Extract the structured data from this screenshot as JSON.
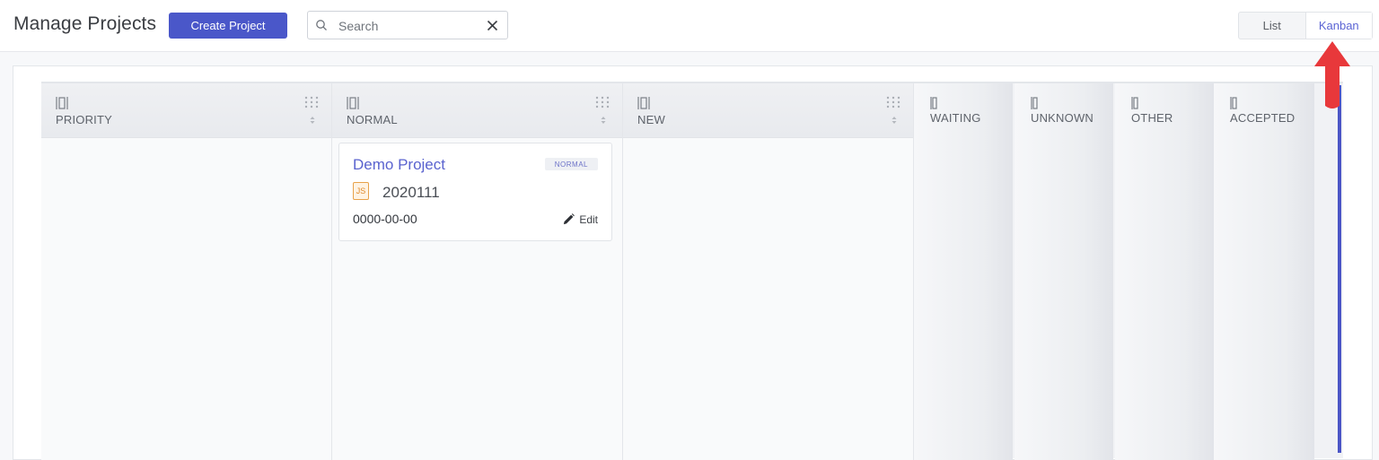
{
  "header": {
    "title": "Manage Projects",
    "create_label": "Create Project",
    "search_placeholder": "Search",
    "view_list": "List",
    "view_kanban": "Kanban"
  },
  "columns": [
    {
      "title": "PRIORITY"
    },
    {
      "title": "NORMAL"
    },
    {
      "title": "NEW"
    }
  ],
  "collapsed_columns": [
    {
      "title": "WAITING"
    },
    {
      "title": "UNKNOWN"
    },
    {
      "title": "OTHER"
    },
    {
      "title": "ACCEPTED"
    }
  ],
  "card": {
    "name": "Demo Project",
    "status": "NORMAL",
    "type_icon": "JS",
    "code": "2020111",
    "date": "0000-00-00",
    "edit_label": "Edit"
  },
  "colors": {
    "accent": "#4a57c9",
    "annotation": "#e8383b"
  }
}
